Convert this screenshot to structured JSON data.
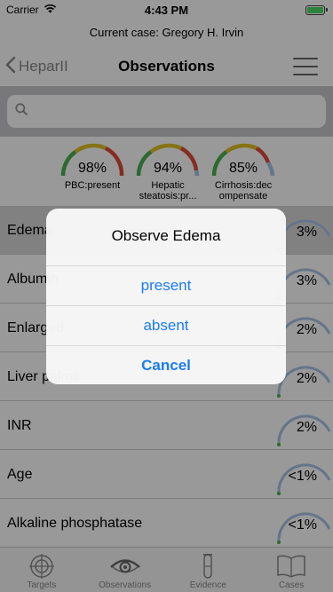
{
  "status_bar": {
    "carrier": "Carrier",
    "time": "4:43 PM"
  },
  "case_bar": {
    "text": "Current case: Gregory H. Irvin"
  },
  "nav": {
    "back_label": "HeparII",
    "title": "Observations"
  },
  "search": {
    "placeholder": ""
  },
  "top_gauges": [
    {
      "percent": "98%",
      "label": "PBC:present",
      "value": 0.98
    },
    {
      "percent": "94%",
      "label": "Hepatic steatosis:pr...",
      "value": 0.94
    },
    {
      "percent": "85%",
      "label": "Cirrhosis:dec ompensate",
      "value": 0.85
    }
  ],
  "observations": [
    {
      "name": "Edema",
      "percent": "3%",
      "value": 0.03
    },
    {
      "name": "Albumin",
      "percent": "3%",
      "value": 0.03
    },
    {
      "name": "Enlarged",
      "percent": "2%",
      "value": 0.02
    },
    {
      "name": "Liver palms",
      "percent": "2%",
      "value": 0.02
    },
    {
      "name": "INR",
      "percent": "2%",
      "value": 0.02
    },
    {
      "name": "Age",
      "percent": "<1%",
      "value": 0.005
    },
    {
      "name": "Alkaline phosphatase",
      "percent": "<1%",
      "value": 0.005
    }
  ],
  "tabs": [
    {
      "label": "Targets",
      "icon": "crosshair-icon"
    },
    {
      "label": "Observations",
      "icon": "eye-icon"
    },
    {
      "label": "Evidence",
      "icon": "test-tube-icon"
    },
    {
      "label": "Cases",
      "icon": "book-icon"
    }
  ],
  "alert": {
    "title": "Observe Edema",
    "options": [
      "present",
      "absent"
    ],
    "cancel_label": "Cancel"
  },
  "colors": {
    "accent_blue": "#1b7cf2",
    "gauge_green": "#4caf50",
    "gauge_yellow": "#e0c020",
    "gauge_red": "#e04a3a",
    "gauge_track": "#a9c4e4"
  }
}
